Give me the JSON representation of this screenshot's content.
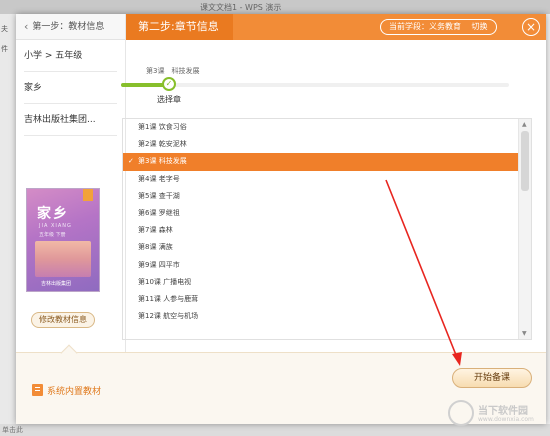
{
  "background": {
    "title": "课文文档1 - WPS 演示",
    "left_labels": [
      "件",
      "夫"
    ],
    "status_text": "单击此"
  },
  "dialog": {
    "step1_label": "第一步：教材信息",
    "info_items": [
      "小学 > 五年级",
      "家乡",
      "吉林出版社集团..."
    ],
    "book": {
      "title": "家乡",
      "subtitle": "JIA XIANG",
      "subtitle2": "五年级 下册",
      "publisher": "吉林出版集团"
    },
    "edit_button": "修改教材信息",
    "step2_label": "第二步:章节信息",
    "school_label": "当前学段：义务教育",
    "switch_label": "切换",
    "progress": {
      "current_lesson": "第3课　科技发展",
      "caption": "选择章",
      "fraction": 0.13
    },
    "lessons": [
      {
        "num": "第1课",
        "name": "饮食习俗"
      },
      {
        "num": "第2课",
        "name": "乾安泥林"
      },
      {
        "num": "第3课",
        "name": "科技发展",
        "selected": true
      },
      {
        "num": "第4课",
        "name": "老字号"
      },
      {
        "num": "第5课",
        "name": "查干湖"
      },
      {
        "num": "第6课",
        "name": "罗继祖"
      },
      {
        "num": "第7课",
        "name": "森林"
      },
      {
        "num": "第8课",
        "name": "满族"
      },
      {
        "num": "第9课",
        "name": "四平市"
      },
      {
        "num": "第10课",
        "name": "广播电视"
      },
      {
        "num": "第11课",
        "name": "人参与鹿茸"
      },
      {
        "num": "第12课",
        "name": "航空与机场"
      }
    ],
    "footer_label": "系统内置教材",
    "start_button": "开始备课"
  },
  "watermark": {
    "title": "当下软件园",
    "url": "www.downxia.com"
  },
  "colors": {
    "accent": "#f28c37",
    "selected_row": "#f07f2a",
    "progress": "#87bf2b",
    "arrow": "#e8251f"
  },
  "icons": [
    "chevron-left-icon",
    "close-icon",
    "check-icon",
    "book-icon"
  ]
}
